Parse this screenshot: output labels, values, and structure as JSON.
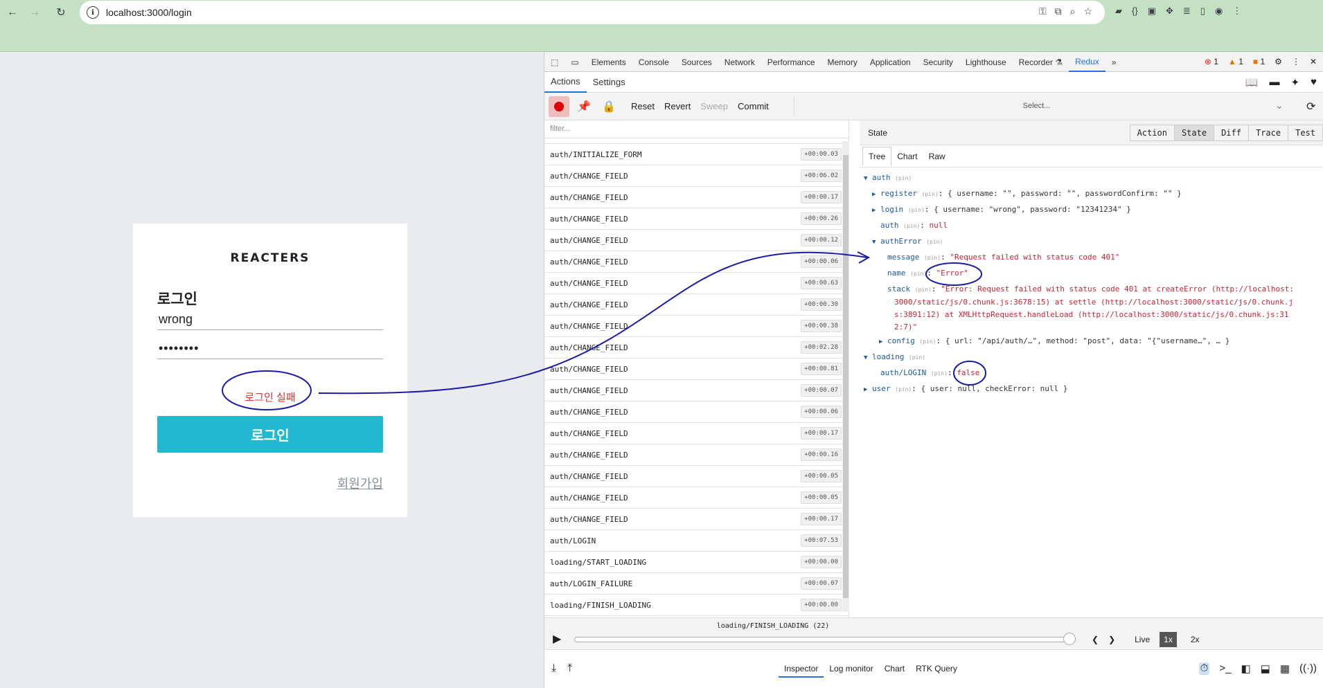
{
  "browser": {
    "url": "localhost:3000/login",
    "nav": {
      "back": "←",
      "forward": "→",
      "reload": "↻"
    }
  },
  "login_page": {
    "brand": "REACTERS",
    "title": "로그인",
    "username_value": "wrong",
    "password_value": "••••••••",
    "error": "로그인 실패",
    "submit": "로그인",
    "signup_link": "회원가입"
  },
  "devtools": {
    "tabs": [
      "Elements",
      "Console",
      "Sources",
      "Network",
      "Performance",
      "Memory",
      "Application",
      "Security",
      "Lighthouse",
      "Recorder ⚗",
      "Redux"
    ],
    "more": "»",
    "badges": {
      "errors": "1",
      "warnings": "1",
      "issues": "1"
    },
    "sub_tabs": [
      "Actions",
      "Settings"
    ],
    "toolbar": {
      "reset": "Reset",
      "revert": "Revert",
      "sweep": "Sweep",
      "commit": "Commit",
      "select_placeholder": "Select..."
    },
    "filter_placeholder": "filter...",
    "actions": [
      {
        "name": "auth/INITIALIZE_FORM",
        "time": "+00:00.03"
      },
      {
        "name": "auth/CHANGE_FIELD",
        "time": "+00:06.02"
      },
      {
        "name": "auth/CHANGE_FIELD",
        "time": "+00:00.17"
      },
      {
        "name": "auth/CHANGE_FIELD",
        "time": "+00:00.26"
      },
      {
        "name": "auth/CHANGE_FIELD",
        "time": "+00:00.12"
      },
      {
        "name": "auth/CHANGE_FIELD",
        "time": "+00:00.06"
      },
      {
        "name": "auth/CHANGE_FIELD",
        "time": "+00:00.63"
      },
      {
        "name": "auth/CHANGE_FIELD",
        "time": "+00:00.30"
      },
      {
        "name": "auth/CHANGE_FIELD",
        "time": "+00:00.38"
      },
      {
        "name": "auth/CHANGE_FIELD",
        "time": "+00:02.28"
      },
      {
        "name": "auth/CHANGE_FIELD",
        "time": "+00:00.81"
      },
      {
        "name": "auth/CHANGE_FIELD",
        "time": "+00:00.07"
      },
      {
        "name": "auth/CHANGE_FIELD",
        "time": "+00:00.06"
      },
      {
        "name": "auth/CHANGE_FIELD",
        "time": "+00:00.17"
      },
      {
        "name": "auth/CHANGE_FIELD",
        "time": "+00:00.16"
      },
      {
        "name": "auth/CHANGE_FIELD",
        "time": "+00:00.05"
      },
      {
        "name": "auth/CHANGE_FIELD",
        "time": "+00:00.05"
      },
      {
        "name": "auth/CHANGE_FIELD",
        "time": "+00:00.17"
      },
      {
        "name": "auth/LOGIN",
        "time": "+00:07.53"
      },
      {
        "name": "loading/START_LOADING",
        "time": "+00:00.00"
      },
      {
        "name": "auth/LOGIN_FAILURE",
        "time": "+00:00.07"
      },
      {
        "name": "loading/FINISH_LOADING",
        "time": "+00:00.00"
      }
    ],
    "state_title": "State",
    "state_segments": [
      "Action",
      "State",
      "Diff",
      "Trace",
      "Test"
    ],
    "tree_tabs": [
      "Tree",
      "Chart",
      "Raw"
    ],
    "tree": {
      "auth": "auth",
      "register": "register",
      "register_val": "{ username: \"\", password: \"\", passwordConfirm: \"\" }",
      "login": "login",
      "login_val": "{ username: \"wrong\", password: \"12341234\" }",
      "auth_key": "auth",
      "auth_val": "null",
      "authError": "authError",
      "message": "message",
      "message_val": "\"Request failed with status code 401\"",
      "name": "name",
      "name_val": "\"Error\"",
      "stack": "stack",
      "stack_val_1": "\"Error: Request failed with status code 401 at createError (http://localhost:",
      "stack_val_2": "3000/static/js/0.chunk.js:3678:15) at settle (http://localhost:3000/static/js/0.chunk.j",
      "stack_val_3": "s:3891:12) at XMLHttpRequest.handleLoad (http://localhost:3000/static/js/0.chunk.js:31",
      "stack_val_4": "2:7)\"",
      "config": "config",
      "config_val": "{ url: \"/api/auth/…\", method: \"post\", data: \"{\"username…\", … }",
      "loading": "loading",
      "auth_login": "auth/LOGIN",
      "auth_login_val": "false",
      "user": "user",
      "user_val": "{ user: null, checkError: null }",
      "pin": "(pin)"
    },
    "slider_label": "loading/FINISH_LOADING (22)",
    "slider_progress": 1.0,
    "live": "Live",
    "speed_1x": "1x",
    "speed_2x": "2x",
    "bottom_tabs": [
      "Inspector",
      "Log monitor",
      "Chart",
      "RTK Query"
    ]
  }
}
